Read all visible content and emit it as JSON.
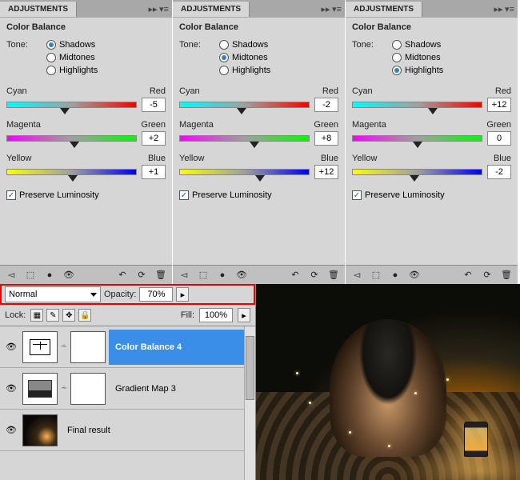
{
  "panel_tab_label": "ADJUSTMENTS",
  "panel_title": "Color Balance",
  "tone_label": "Tone:",
  "tone_options": [
    "Shadows",
    "Midtones",
    "Highlights"
  ],
  "sliders": [
    {
      "left": "Cyan",
      "right": "Red"
    },
    {
      "left": "Magenta",
      "right": "Green"
    },
    {
      "left": "Yellow",
      "right": "Blue"
    }
  ],
  "preserve_label": "Preserve Luminosity",
  "panels": [
    {
      "tone_selected": 0,
      "values": [
        -5,
        2,
        1
      ],
      "thumb_pos": [
        45,
        52,
        51
      ]
    },
    {
      "tone_selected": 1,
      "values": [
        -2,
        8,
        12
      ],
      "thumb_pos": [
        48,
        58,
        62
      ]
    },
    {
      "tone_selected": 2,
      "values": [
        12,
        0,
        -2
      ],
      "thumb_pos": [
        62,
        50,
        48
      ]
    }
  ],
  "layers_panel": {
    "blend_mode": "Normal",
    "opacity_label": "Opacity:",
    "opacity_value": "70%",
    "lock_label": "Lock:",
    "fill_label": "Fill:",
    "fill_value": "100%",
    "layers": [
      {
        "name": "Color Balance 4",
        "selected": true,
        "type": "adjustment"
      },
      {
        "name": "Gradient Map 3",
        "selected": false,
        "type": "gradmap"
      },
      {
        "name": "Final result",
        "selected": false,
        "type": "image"
      }
    ]
  },
  "chart_data": {
    "type": "table",
    "title": "Color Balance adjustment settings",
    "series": [
      {
        "name": "Shadows",
        "channels": [
          "Cyan/Red",
          "Magenta/Green",
          "Yellow/Blue"
        ],
        "values": [
          -5,
          2,
          1
        ]
      },
      {
        "name": "Midtones",
        "channels": [
          "Cyan/Red",
          "Magenta/Green",
          "Yellow/Blue"
        ],
        "values": [
          -2,
          8,
          12
        ]
      },
      {
        "name": "Highlights",
        "channels": [
          "Cyan/Red",
          "Magenta/Green",
          "Yellow/Blue"
        ],
        "values": [
          12,
          0,
          -2
        ]
      }
    ],
    "range": [
      -100,
      100
    ],
    "preserve_luminosity": true
  }
}
